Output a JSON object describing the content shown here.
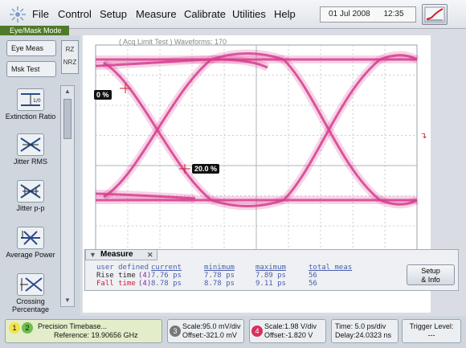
{
  "menubar": {
    "items": [
      "File",
      "Control",
      "Setup",
      "Measure",
      "Calibrate",
      "Utilities",
      "Help"
    ],
    "date": "01 Jul 2008",
    "time": "12:35"
  },
  "mode": {
    "title": "Eye/Mask Mode"
  },
  "left_panel": {
    "eye_meas_label": "Eye Meas",
    "mask_test_label": "Msk Test",
    "rz_label": "RZ",
    "nrz_label": "NRZ",
    "tools": [
      {
        "label": "Extinction Ratio",
        "icon": "extinction-ratio-icon"
      },
      {
        "label": "Jitter RMS",
        "icon": "jitter-rms-icon"
      },
      {
        "label": "Jitter p-p",
        "icon": "jitter-pp-icon"
      },
      {
        "label": "Average Power",
        "icon": "average-power-icon"
      },
      {
        "label": "Crossing Percentage",
        "icon": "crossing-percentage-icon"
      }
    ]
  },
  "screen": {
    "header": "( Acq Limit Test )  Waveforms: 170",
    "readout_left": "0 %",
    "readout_center": "20.0 %",
    "waveform_color": "#d63d8f"
  },
  "measure": {
    "title": "Measure",
    "columns": [
      "user defined",
      "current",
      "minimum",
      "maximum",
      "total meas"
    ],
    "rows": [
      {
        "name": "Rise time",
        "ch": "(4)",
        "current": "7.76 ps",
        "minimum": "7.78 ps",
        "maximum": "7.89 ps",
        "total": "56",
        "color": "#2a2a2a"
      },
      {
        "name": "Fall time",
        "ch": "(4)",
        "current": "8.78 ps",
        "minimum": "8.78 ps",
        "maximum": "9.11 ps",
        "total": "56",
        "color": "#cc1f3a"
      }
    ],
    "setup_label_1": "Setup",
    "setup_label_2": "& Info"
  },
  "statusbar": {
    "timebase_line1": "Precision Timebase...",
    "timebase_line2": "Reference: 19.90656 GHz",
    "ch3_scale": "Scale:95.0 mV/div",
    "ch3_offset": "Offset:-321.0 mV",
    "ch4_scale": "Scale:1.98 V/div",
    "ch4_offset": "Offset:-1.820 V",
    "time_scale": "Time:  5.0 ps/div",
    "time_delay": "Delay:24.0323 ns",
    "trigger_label": "Trigger Level:",
    "trigger_value": "---"
  }
}
